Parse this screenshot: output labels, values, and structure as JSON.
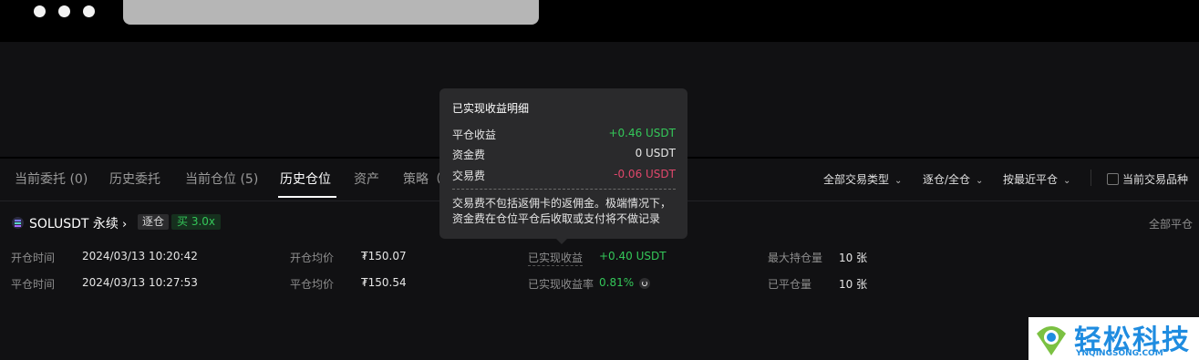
{
  "tabs": {
    "items": [
      {
        "label": "当前委托 (0)"
      },
      {
        "label": "历史委托"
      },
      {
        "label": "当前仓位 (5)"
      },
      {
        "label": "历史仓位"
      },
      {
        "label": "资产"
      },
      {
        "label": "策略（"
      }
    ],
    "active_index": 3
  },
  "filters": {
    "trade_type": "全部交易类型",
    "margin_mode": "逐仓/全仓",
    "sort": "按最近平仓",
    "current_symbol_checkbox": "当前交易品种"
  },
  "position": {
    "symbol": "SOLUSDT 永续",
    "arrow": "›",
    "mode_badge": "逐仓",
    "side_badge": "买 3.0x",
    "close_all": "全部平仓",
    "rows": {
      "open_time_label": "开仓时间",
      "open_time_value": "2024/03/13 10:20:42",
      "open_avg_label": "开仓均价",
      "open_avg_value": "₮150.07",
      "realized_pnl_label": "已实现收益",
      "realized_pnl_value": "+0.40 USDT",
      "max_hold_label": "最大持仓量",
      "max_hold_value": "10 张",
      "close_time_label": "平仓时间",
      "close_time_value": "2024/03/13 10:27:53",
      "close_avg_label": "平仓均价",
      "close_avg_value": "₮150.54",
      "realized_rate_label": "已实现收益率",
      "realized_rate_value": "0.81%",
      "closed_qty_label": "已平仓量",
      "closed_qty_value": "10 张"
    }
  },
  "tooltip": {
    "title": "已实现收益明细",
    "rows": [
      {
        "label": "平仓收益",
        "value": "+0.46 USDT"
      },
      {
        "label": "资金费",
        "value": "0 USDT"
      },
      {
        "label": "交易费",
        "value": "-0.06 USDT"
      }
    ],
    "note": "交易费不包括返佣卡的返佣金。极端情况下，资金费在仓位平仓后收取或支付将不做记录"
  },
  "watermark": {
    "text": "轻松科技",
    "sub": "YNQINGSONG.COM"
  },
  "colors": {
    "positive": "#34c759",
    "negative": "#e0476b",
    "background": "#111113"
  },
  "icons": {
    "chevron": "chevron-down-icon",
    "refresh": "refresh-icon",
    "symbol": "solana-icon"
  }
}
